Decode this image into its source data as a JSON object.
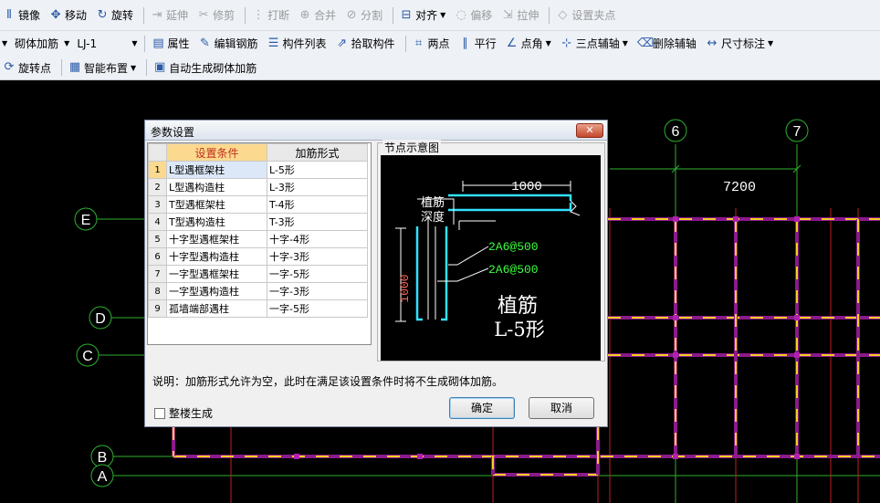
{
  "toolbar1": {
    "items": [
      {
        "label": "镜像",
        "icon": "mirror-icon",
        "enabled": true
      },
      {
        "label": "移动",
        "icon": "move-icon",
        "enabled": true
      },
      {
        "label": "旋转",
        "icon": "rotate-icon",
        "enabled": true
      },
      {
        "label": "延伸",
        "icon": "extend-icon",
        "enabled": false
      },
      {
        "label": "修剪",
        "icon": "trim-icon",
        "enabled": false
      },
      {
        "label": "打断",
        "icon": "break-icon",
        "enabled": false
      },
      {
        "label": "合并",
        "icon": "merge-icon",
        "enabled": false
      },
      {
        "label": "分割",
        "icon": "split-icon",
        "enabled": false
      },
      {
        "label": "对齐",
        "icon": "align-icon",
        "enabled": true
      },
      {
        "label": "偏移",
        "icon": "offset-icon",
        "enabled": false
      },
      {
        "label": "拉伸",
        "icon": "stretch-icon",
        "enabled": false
      },
      {
        "label": "设置夹点",
        "icon": "grip-icon",
        "enabled": false
      }
    ]
  },
  "toolbar2": {
    "type_combo": "砌体加筋",
    "name_combo": "LJ-1",
    "items": [
      {
        "label": "属性",
        "icon": "property-icon"
      },
      {
        "label": "编辑钢筋",
        "icon": "edit-rebar-icon"
      },
      {
        "label": "构件列表",
        "icon": "component-list-icon"
      },
      {
        "label": "拾取构件",
        "icon": "pick-icon"
      },
      {
        "label": "两点",
        "icon": "two-point-icon"
      },
      {
        "label": "平行",
        "icon": "parallel-icon"
      },
      {
        "label": "点角",
        "icon": "point-angle-icon"
      },
      {
        "label": "三点辅轴",
        "icon": "three-point-axis-icon"
      },
      {
        "label": "删除辅轴",
        "icon": "delete-axis-icon"
      },
      {
        "label": "尺寸标注",
        "icon": "dimension-icon"
      }
    ]
  },
  "toolbar3": {
    "items": [
      {
        "label": "旋转点",
        "icon": "rotate-point-icon"
      },
      {
        "label": "智能布置",
        "icon": "smart-layout-icon"
      },
      {
        "label": "自动生成砌体加筋",
        "icon": "auto-generate-icon"
      }
    ]
  },
  "canvas": {
    "axis_top": [
      "6",
      "7"
    ],
    "axis_left": [
      "E",
      "D",
      "C",
      "B",
      "A"
    ],
    "dimension": "7200"
  },
  "dialog": {
    "title": "参数设置",
    "close_glyph": "✕",
    "col_condition": "设置条件",
    "col_form": "加筋形式",
    "rows": [
      {
        "no": "1",
        "condition": "L型遇框架柱",
        "form": "L-5形"
      },
      {
        "no": "2",
        "condition": "L型遇构造柱",
        "form": "L-3形"
      },
      {
        "no": "3",
        "condition": "T型遇框架柱",
        "form": "T-4形"
      },
      {
        "no": "4",
        "condition": "T型遇构造柱",
        "form": "T-3形"
      },
      {
        "no": "5",
        "condition": "十字型遇框架柱",
        "form": "十字-4形"
      },
      {
        "no": "6",
        "condition": "十字型遇构造柱",
        "form": "十字-3形"
      },
      {
        "no": "7",
        "condition": "一字型遇框架柱",
        "form": "一字-5形"
      },
      {
        "no": "8",
        "condition": "一字型遇构造柱",
        "form": "一字-3形"
      },
      {
        "no": "9",
        "condition": "孤墙端部遇柱",
        "form": "一字-5形"
      }
    ],
    "node_group_label": "节点示意图",
    "node_diagram": {
      "dim_top": "1000",
      "dim_left": "1000",
      "label_plant": "植筋",
      "label_depth": "深度",
      "rebar1": "2A6@500",
      "rebar2": "2A6@500",
      "big_label": "植筋",
      "form_label": "L-5形"
    },
    "note": "说明：加筋形式允许为空，此时在满足该设置条件时将不生成砌体加筋。",
    "checkbox_label": "整楼生成",
    "ok_label": "确定",
    "cancel_label": "取消"
  }
}
